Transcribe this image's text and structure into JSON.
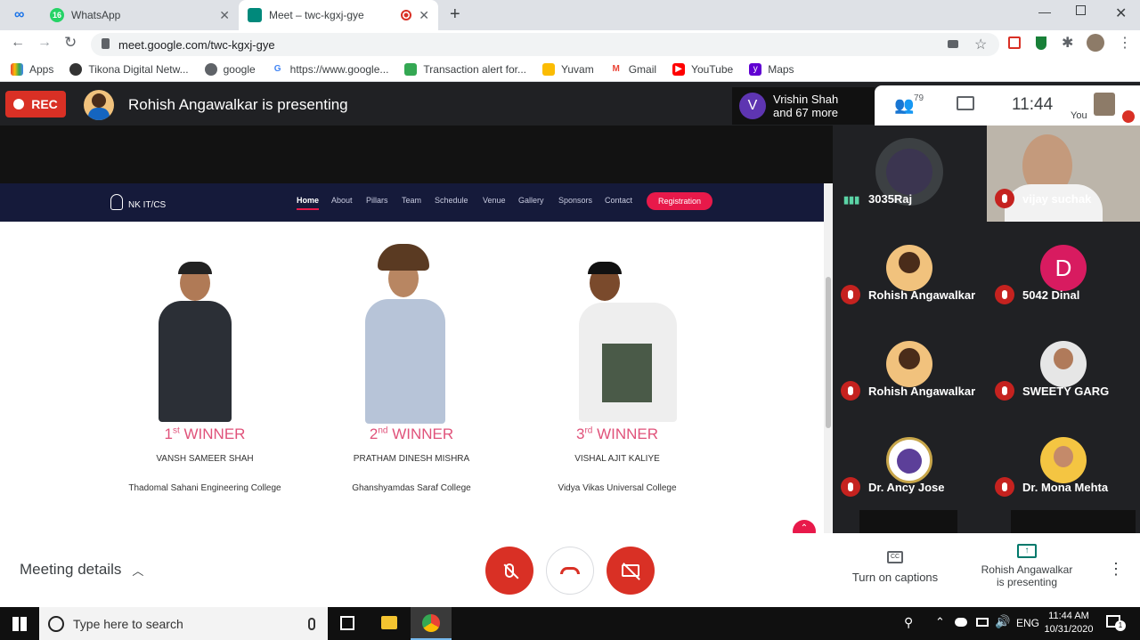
{
  "browser": {
    "tabs": [
      {
        "title": "",
        "icon": "loop-icon"
      },
      {
        "title": "WhatsApp",
        "badge": "16"
      },
      {
        "title": "Meet – twc-kgxj-gye",
        "active": true
      }
    ],
    "url": "meet.google.com/twc-kgxj-gye",
    "bookmarks": [
      "Apps",
      "Tikona Digital Netw...",
      "google",
      "https://www.google...",
      "Transaction alert for...",
      "Yuvam",
      "Gmail",
      "YouTube",
      "Maps"
    ]
  },
  "meet": {
    "rec_label": "REC",
    "presenting_text": "Rohish Angawalkar is presenting",
    "raised": {
      "initial": "V",
      "line1": "Vrishin Shah",
      "line2": "and 67 more"
    },
    "participants_count": "79",
    "time": "11:44",
    "you_label": "You",
    "tiles": [
      {
        "name": "3035Raj",
        "muted": false
      },
      {
        "name": "vijay suchak",
        "muted": true
      },
      {
        "name": "Rohish Angawalkar",
        "muted": true
      },
      {
        "name": "5042 Dinal",
        "muted": true,
        "initial": "D"
      },
      {
        "name": "Rohish Angawalkar",
        "muted": true
      },
      {
        "name": "SWEETY GARG",
        "muted": true
      },
      {
        "name": "Dr. Ancy Jose",
        "muted": true
      },
      {
        "name": "Dr. Mona Mehta",
        "muted": true
      }
    ],
    "meeting_details": "Meeting details",
    "captions": "Turn on captions",
    "presenting_line1": "Rohish Angawalkar",
    "presenting_line2": "is presenting"
  },
  "slide": {
    "logo": "NK IT/CS",
    "nav": [
      "Home",
      "About",
      "Pillars",
      "Team",
      "Schedule",
      "Venue",
      "Gallery",
      "Sponsors",
      "Contact"
    ],
    "registration": "Registration",
    "winners": [
      {
        "rank": "1",
        "suffix": "st",
        "label": "WINNER",
        "name": "VANSH SAMEER SHAH",
        "college": "Thadomal Sahani Engineering College"
      },
      {
        "rank": "2",
        "suffix": "nd",
        "label": "WINNER",
        "name": "PRATHAM DINESH MISHRA",
        "college": "Ghanshyamdas Saraf College"
      },
      {
        "rank": "3",
        "suffix": "rd",
        "label": "WINNER",
        "name": "VISHAL AJIT KALIYE",
        "college": "Vidya Vikas Universal College"
      }
    ]
  },
  "taskbar": {
    "search_placeholder": "Type here to search",
    "lang": "ENG",
    "time": "11:44 AM",
    "date": "10/31/2020",
    "notif_count": "1"
  }
}
